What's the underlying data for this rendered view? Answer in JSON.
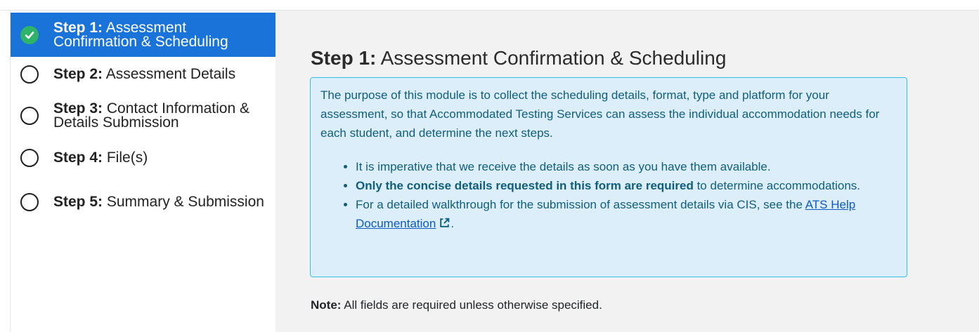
{
  "sidebar": {
    "steps": [
      {
        "num": "Step 1:",
        "label": "Assessment Confirmation & Scheduling",
        "status": "complete",
        "icon": "check-circle-icon"
      },
      {
        "num": "Step 2:",
        "label": "Assessment Details",
        "status": "incomplete",
        "icon": "empty-circle-icon"
      },
      {
        "num": "Step 3:",
        "label": "Contact Information & Details Submission",
        "status": "incomplete",
        "icon": "empty-circle-icon"
      },
      {
        "num": "Step 4:",
        "label": "File(s)",
        "status": "incomplete",
        "icon": "empty-circle-icon"
      },
      {
        "num": "Step 5:",
        "label": "Summary & Submission",
        "status": "incomplete",
        "icon": "empty-circle-icon"
      }
    ]
  },
  "main": {
    "title_prefix": "Step 1:",
    "title_text": "Assessment Confirmation & Scheduling",
    "info": {
      "paragraph": "The purpose of this module is to collect the scheduling details, format, type and platform for your assessment, so that Accommodated Testing Services can assess the individual accommodation needs for each student, and determine the next steps.",
      "bullets": [
        {
          "prefix": "It is imperative that we receive the details as soon as you have them available.",
          "bold": "",
          "suffix": ""
        },
        {
          "prefix": "",
          "bold": "Only the concise details requested in this form are required",
          "suffix": " to determine accommodations."
        },
        {
          "prefix": "For a detailed walkthrough for the submission of assessment details via CIS, see the ",
          "link": "ATS Help Documentation",
          "suffix": "."
        }
      ]
    },
    "note": {
      "label": "Note:",
      "text": " All fields are required unless otherwise specified."
    }
  },
  "colors": {
    "active_step_bg": "#1a73d9",
    "complete_check": "#2fb36b",
    "info_bg": "#dbeef9",
    "info_border": "#35c0e8",
    "info_text": "#0f5e7e",
    "link": "#0d59c8"
  }
}
